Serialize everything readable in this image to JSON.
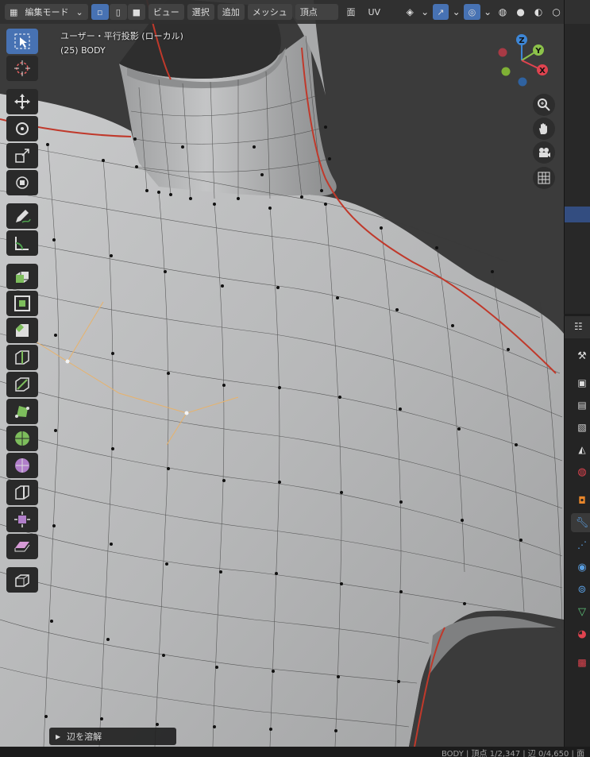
{
  "header": {
    "mode_label": "編集モード",
    "menus": [
      "ビュー",
      "選択",
      "追加",
      "メッシュ",
      "頂点",
      "面",
      "UV"
    ]
  },
  "viewport": {
    "view_label": "ユーザー・平行投影 (ローカル)",
    "object_label": "(25) BODY"
  },
  "gizmo": {
    "z": "Z",
    "y": "Y",
    "x": "X",
    "colors": {
      "x": "#e0434f",
      "y": "#8cc24a",
      "z": "#3d86d6"
    }
  },
  "toolbar_tools": [
    "select-box",
    "cursor",
    "move",
    "rotate",
    "scale",
    "transform",
    "annotate",
    "measure",
    "extrude-region",
    "inset-faces",
    "bevel",
    "loop-cut",
    "knife",
    "poly-build",
    "spin",
    "smooth",
    "edge-slide",
    "shrink-fatten",
    "shear",
    "to-sphere"
  ],
  "properties_tabs": [
    "tool",
    "render",
    "output",
    "view-layer",
    "scene",
    "world",
    "object",
    "modifiers",
    "particles",
    "physics",
    "constraints",
    "data",
    "material",
    "texture"
  ],
  "last_operation": {
    "label": "辺を溶解"
  },
  "statusbar": {
    "text": "BODY | 頂点 1/2,347 | 辺 0/4,650 | 面"
  },
  "accent_color": "#4772b3"
}
